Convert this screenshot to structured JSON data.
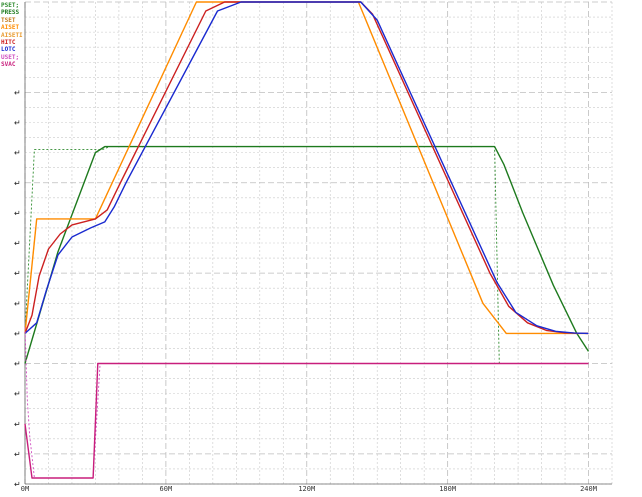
{
  "chart_data": {
    "type": "line",
    "legend_position": "top-left",
    "grid": true,
    "xlim": [
      0,
      250
    ],
    "ylim": [
      -4,
      12
    ],
    "x_ticks": [
      {
        "value": 0,
        "label": "0M"
      },
      {
        "value": 60,
        "label": "60M"
      },
      {
        "value": 120,
        "label": "120M"
      },
      {
        "value": 180,
        "label": "180M"
      },
      {
        "value": 240,
        "label": "240M"
      }
    ],
    "series": [
      {
        "name": "PSET;",
        "color": "#2e8b2e",
        "style": "dashed",
        "points": [
          [
            0,
            1
          ],
          [
            4,
            7.1
          ],
          [
            33,
            7.1
          ],
          [
            36,
            7.2
          ],
          [
            200,
            7.2
          ],
          [
            202,
            0
          ],
          [
            203,
            0
          ]
        ]
      },
      {
        "name": "PRESS",
        "color": "#1e7a1e",
        "style": "solid",
        "points": [
          [
            0,
            0
          ],
          [
            14,
            3.7
          ],
          [
            30,
            7
          ],
          [
            34,
            7.2
          ],
          [
            200,
            7.2
          ],
          [
            204,
            6.6
          ],
          [
            212,
            5
          ],
          [
            225,
            2.6
          ],
          [
            235,
            1
          ],
          [
            240,
            0.4
          ]
        ]
      },
      {
        "name": "TSET",
        "color": "#c47a1a",
        "style": "dashed",
        "points": [
          [
            0,
            1
          ],
          [
            5,
            4.8
          ],
          [
            30,
            4.8
          ],
          [
            73,
            12
          ],
          [
            142,
            12
          ],
          [
            195,
            2
          ],
          [
            205,
            1
          ],
          [
            212,
            1
          ],
          [
            240,
            1
          ]
        ]
      },
      {
        "name": "AISET",
        "color": "#ff8c00",
        "style": "solid",
        "points": [
          [
            0,
            1
          ],
          [
            5,
            4.8
          ],
          [
            30,
            4.8
          ],
          [
            73,
            12
          ],
          [
            142,
            12
          ],
          [
            195,
            2
          ],
          [
            205,
            1
          ],
          [
            212,
            1
          ],
          [
            240,
            1
          ]
        ]
      },
      {
        "name": "AISETI",
        "color": "#e89a2e",
        "style": "solid",
        "points": []
      },
      {
        "name": "HITC",
        "color": "#cc2020",
        "style": "solid",
        "points": [
          [
            0,
            1
          ],
          [
            3,
            1.6
          ],
          [
            6,
            2.9
          ],
          [
            10,
            3.8
          ],
          [
            15,
            4.3
          ],
          [
            20,
            4.6
          ],
          [
            30,
            4.8
          ],
          [
            35,
            5.1
          ],
          [
            40,
            5.9
          ],
          [
            77,
            11.7
          ],
          [
            85,
            12
          ],
          [
            143,
            12
          ],
          [
            148,
            11.6
          ],
          [
            198,
            3
          ],
          [
            206,
            1.9
          ],
          [
            214,
            1.35
          ],
          [
            222,
            1.1
          ],
          [
            230,
            1.02
          ],
          [
            240,
            1
          ]
        ]
      },
      {
        "name": "LOTC",
        "color": "#1a2ad0",
        "style": "solid",
        "points": [
          [
            0,
            1
          ],
          [
            5,
            1.35
          ],
          [
            9,
            2.4
          ],
          [
            14,
            3.6
          ],
          [
            20,
            4.2
          ],
          [
            28,
            4.5
          ],
          [
            34,
            4.7
          ],
          [
            38,
            5.2
          ],
          [
            43,
            6
          ],
          [
            82,
            11.7
          ],
          [
            92,
            12
          ],
          [
            143,
            12
          ],
          [
            150,
            11.4
          ],
          [
            201,
            2.7
          ],
          [
            209,
            1.7
          ],
          [
            218,
            1.25
          ],
          [
            226,
            1.07
          ],
          [
            234,
            1.01
          ],
          [
            240,
            1
          ]
        ]
      },
      {
        "name": "USET;",
        "color": "#d04ec0",
        "style": "dashed",
        "points": [
          [
            0,
            1.2
          ],
          [
            1,
            -1.2
          ],
          [
            2,
            -2.4
          ],
          [
            4,
            -3.8
          ],
          [
            29,
            -3.8
          ],
          [
            32,
            0
          ],
          [
            240,
            0
          ]
        ]
      },
      {
        "name": "SVAC",
        "color": "#c81e7c",
        "style": "solid",
        "points": [
          [
            0,
            -2
          ],
          [
            3,
            -3.8
          ],
          [
            29,
            -3.8
          ],
          [
            31,
            0
          ],
          [
            240,
            0
          ]
        ]
      }
    ]
  }
}
